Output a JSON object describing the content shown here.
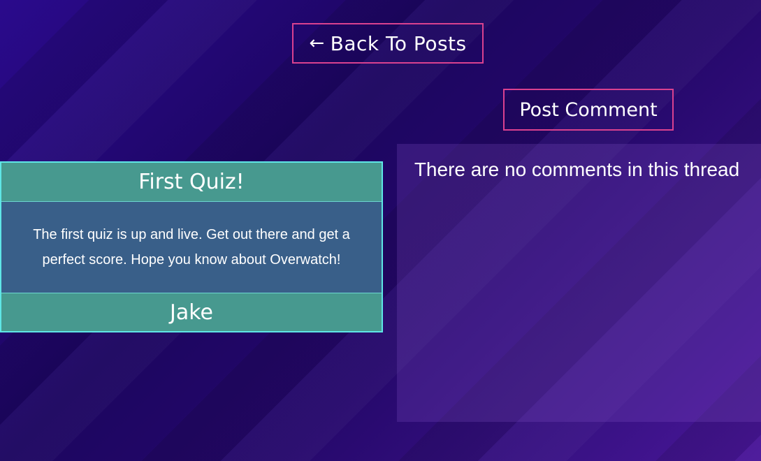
{
  "nav": {
    "back_icon": "arrow-left-icon",
    "back_label": "Back To Posts"
  },
  "actions": {
    "post_comment_label": "Post Comment"
  },
  "post": {
    "title": "First Quiz!",
    "body": "The first quiz is up and live. Get out there and get a perfect score. Hope you know about Overwatch!",
    "author": "Jake"
  },
  "comments": {
    "empty_message": "There are no comments in this thread"
  },
  "colors": {
    "button_border": "#d9418f",
    "card_border": "#5fe6e6",
    "card_header": "#47998f",
    "card_body": "#395f89"
  }
}
